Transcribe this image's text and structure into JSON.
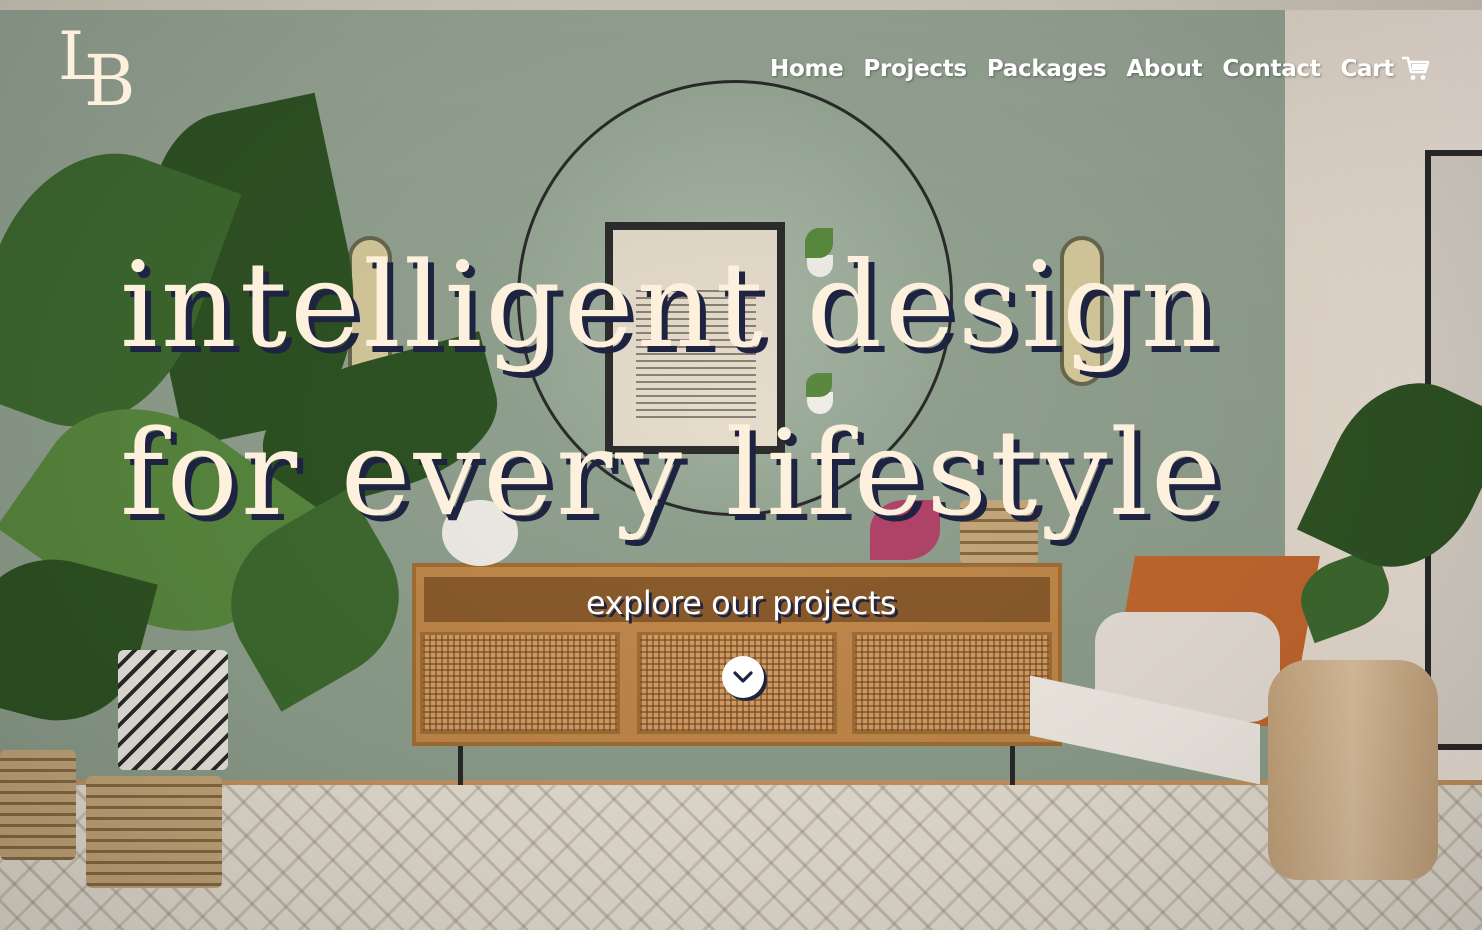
{
  "brand": {
    "logo_letter_1": "L",
    "logo_letter_2": "B",
    "logo_icon": "lb-monogram-logo"
  },
  "nav": {
    "items": [
      {
        "label": "Home"
      },
      {
        "label": "Projects"
      },
      {
        "label": "Packages"
      },
      {
        "label": "About"
      },
      {
        "label": "Contact"
      }
    ],
    "cart_label": "Cart",
    "cart_icon": "shopping-cart-icon"
  },
  "hero": {
    "line_1": "intelligent design",
    "line_2": "for every lifestyle",
    "cta_label": "explore our projects",
    "cta_icon": "chevron-down-icon"
  },
  "colors": {
    "hero_text": "#fdf1dd",
    "hero_shadow": "#1d2340",
    "nav_text": "#ffffff"
  }
}
